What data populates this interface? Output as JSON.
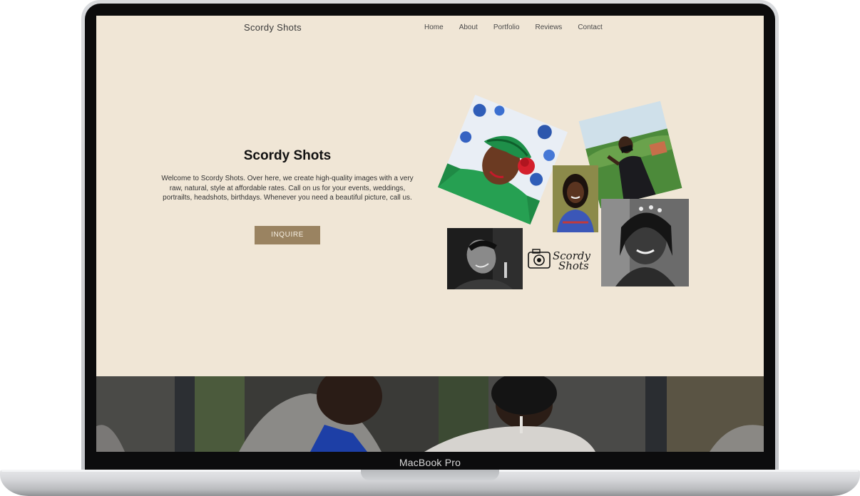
{
  "device": {
    "model_label": "MacBook Pro"
  },
  "site": {
    "brand": "Scordy Shots",
    "nav": [
      "Home",
      "About",
      "Portfolio",
      "Reviews",
      "Contact"
    ],
    "hero": {
      "title": "Scordy Shots",
      "description": "Welcome to Scordy Shots. Over here, we create high-quality images with a very raw, natural, style at affordable rates. Call on us for your events, weddings, portrailts, headshots, birthdays. Whenever you need a beautiful picture, call us.",
      "button": "INQUIRE"
    },
    "collage_logo": {
      "line1": "Scordy",
      "line2": "Shots"
    }
  },
  "colors": {
    "page_bg": "#f0e6d6",
    "button_bg": "#9a8361",
    "button_text": "#f6efe2",
    "text": "#333333"
  }
}
